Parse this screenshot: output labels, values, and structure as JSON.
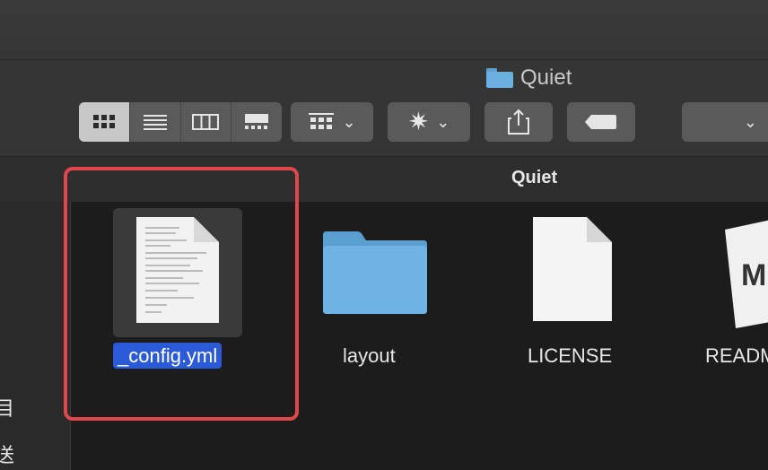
{
  "window": {
    "title": "Quiet"
  },
  "toolbar": {
    "view_modes": [
      "icon-view",
      "list-view",
      "column-view",
      "gallery-view"
    ],
    "active_view": "icon-view"
  },
  "pathbar": {
    "title": "Quiet"
  },
  "sidebar": {
    "items": [
      {
        "label": "目"
      },
      {
        "label": "送"
      }
    ]
  },
  "files": [
    {
      "name": "_config.yml",
      "kind": "document",
      "selected": true
    },
    {
      "name": "layout",
      "kind": "folder",
      "selected": false
    },
    {
      "name": "LICENSE",
      "kind": "blank-document",
      "selected": false
    },
    {
      "name": "READM",
      "kind": "markdown-document",
      "selected": false,
      "icon_text": "M"
    }
  ],
  "colors": {
    "selection": "#2a5ad8",
    "highlight_annotation": "#e0474c",
    "folder": "#6cb0e0"
  }
}
